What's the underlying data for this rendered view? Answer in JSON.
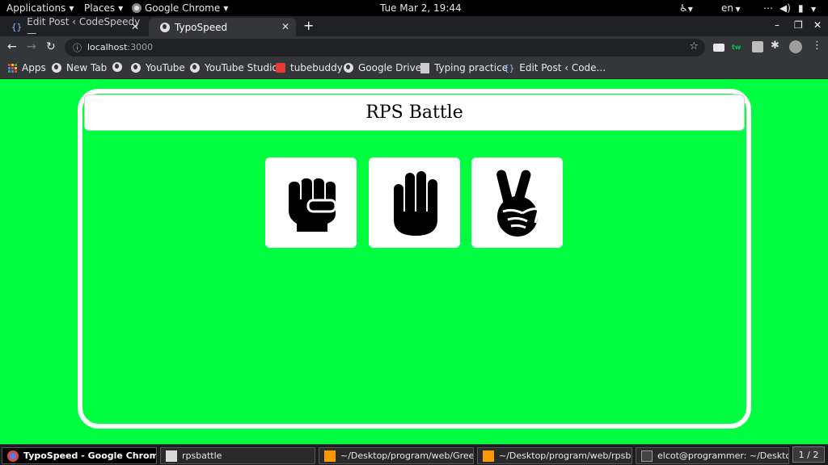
{
  "topbar": {
    "applications": "Applications",
    "places": "Places",
    "active_app": "Google Chrome",
    "clock": "Tue Mar  2, 19:44",
    "language": "en"
  },
  "tabs": [
    {
      "title": "Edit Post ‹ CodeSpeedy —",
      "icon": "{}"
    },
    {
      "title": "TypoSpeed",
      "icon": "globe"
    }
  ],
  "toolbar": {
    "url_host": "localhost",
    "url_port": ":3000"
  },
  "bookmarks": [
    {
      "label": "Apps"
    },
    {
      "label": "New Tab"
    },
    {
      "label": ""
    },
    {
      "label": "YouTube"
    },
    {
      "label": "YouTube Studio"
    },
    {
      "label": "tubebuddy"
    },
    {
      "label": "Google Drive"
    },
    {
      "label": "Typing practice"
    },
    {
      "label": "Edit Post ‹ Code..."
    }
  ],
  "page": {
    "title": "RPS Battle",
    "choices": [
      {
        "name": "rock",
        "icon": "fist-icon"
      },
      {
        "name": "paper",
        "icon": "open-hand-icon"
      },
      {
        "name": "scissors",
        "icon": "peace-hand-icon"
      }
    ],
    "background": "#00ff41"
  },
  "taskbar": {
    "items": [
      {
        "label": "TypoSpeed - Google Chrome"
      },
      {
        "label": "rpsbattle"
      },
      {
        "label": "~/Desktop/program/web/Greeny/..."
      },
      {
        "label": "~/Desktop/program/web/rpsbattl..."
      },
      {
        "label": "elcot@programmer: ~/Desktop/p..."
      }
    ],
    "pager": "1 / 2"
  }
}
